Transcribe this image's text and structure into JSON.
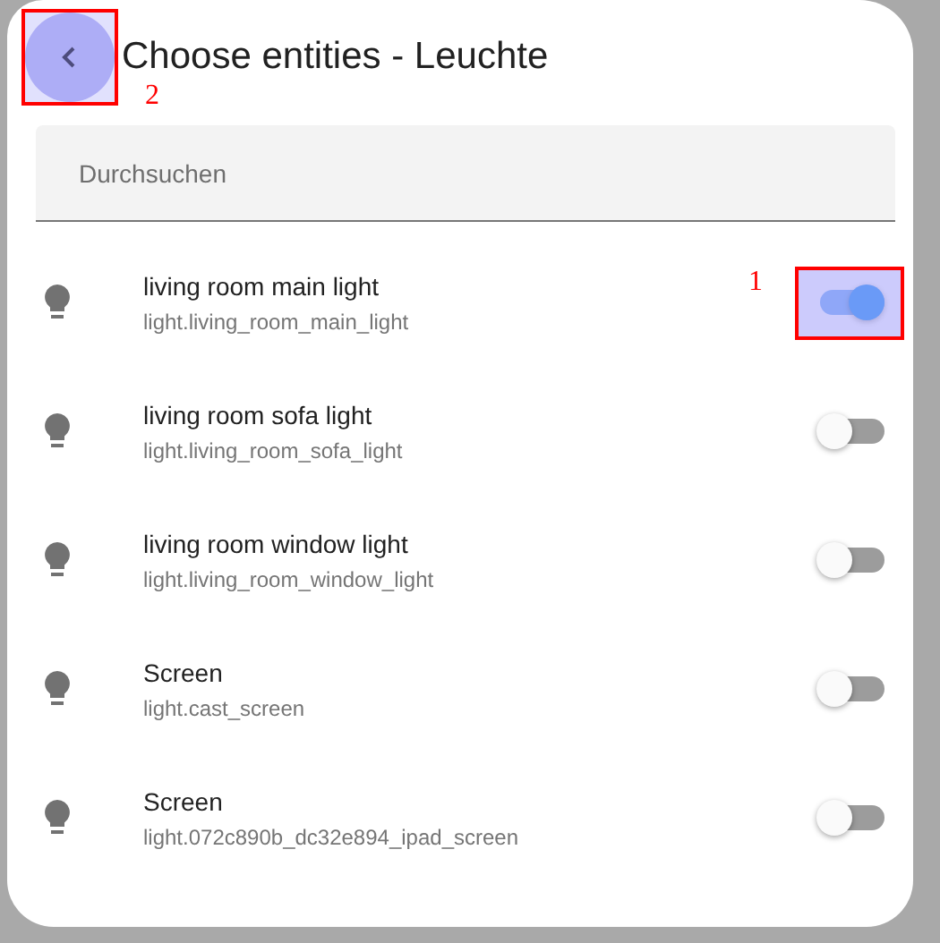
{
  "dialog": {
    "title": "Choose entities - Leuchte",
    "back_button": {
      "highlighted": true,
      "annotation": "2"
    }
  },
  "search": {
    "placeholder": "Durchsuchen"
  },
  "entities": [
    {
      "name": "living room main light",
      "entity_id": "light.living_room_main_light",
      "on": true,
      "annotation": "1"
    },
    {
      "name": "living room sofa light",
      "entity_id": "light.living_room_sofa_light",
      "on": false
    },
    {
      "name": "living room window light",
      "entity_id": "light.living_room_window_light",
      "on": false
    },
    {
      "name": "Screen",
      "entity_id": "light.cast_screen",
      "on": false
    },
    {
      "name": "Screen",
      "entity_id": "light.072c890b_dc32e894_ipad_screen",
      "on": false
    }
  ]
}
